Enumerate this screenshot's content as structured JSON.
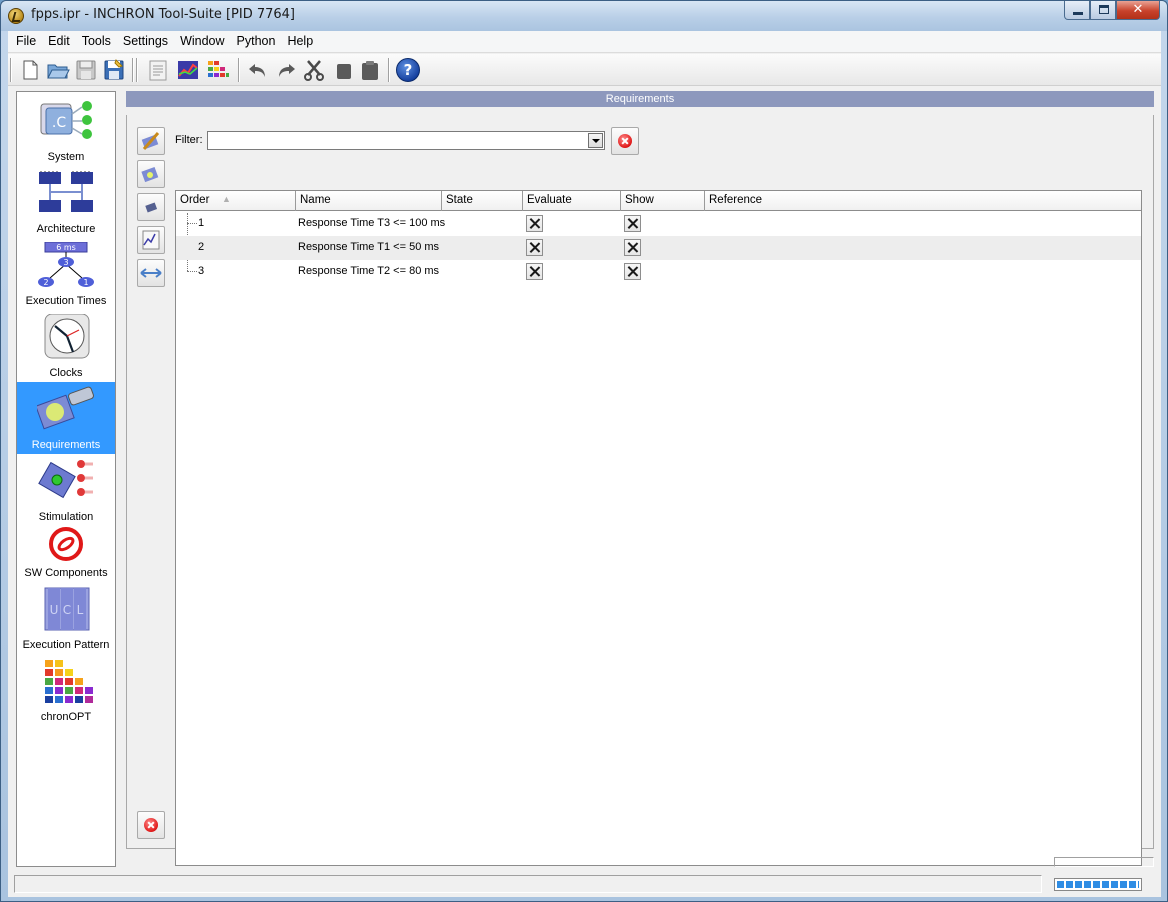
{
  "window": {
    "title": "fpps.ipr - INCHRON Tool-Suite [PID 7764]",
    "close_glyph": "✕"
  },
  "menu": [
    "File",
    "Edit",
    "Tools",
    "Settings",
    "Window",
    "Python",
    "Help"
  ],
  "toolbar": {
    "icons": [
      "new-file-icon",
      "open-folder-icon",
      "save-icon",
      "save-as-icon",
      "report-icon",
      "chart-icon",
      "chronopt-icon",
      "undo-icon",
      "redo-icon",
      "cut-icon",
      "copy-icon",
      "paste-icon",
      "help-icon"
    ],
    "help_glyph": "?"
  },
  "sidebar": {
    "items": [
      {
        "label": "System",
        "icon": "system-icon",
        "active": false
      },
      {
        "label": "Architecture",
        "icon": "architecture-icon",
        "active": false
      },
      {
        "label": "Execution Times",
        "icon": "execution-times-icon",
        "active": false
      },
      {
        "label": "Clocks",
        "icon": "clock-icon",
        "active": false
      },
      {
        "label": "Requirements",
        "icon": "requirements-icon",
        "active": true
      },
      {
        "label": "Stimulation",
        "icon": "stimulation-icon",
        "active": false
      },
      {
        "label": "SW Components",
        "icon": "sw-components-icon",
        "active": false
      },
      {
        "label": "Execution Pattern",
        "icon": "execution-pattern-icon",
        "active": false
      },
      {
        "label": "chronOPT",
        "icon": "chronopt-icon",
        "active": false
      }
    ],
    "exec_times_badge": "6 ms",
    "exec_nodes": [
      "3",
      "2",
      "1"
    ],
    "pattern_letters": [
      "U",
      "C",
      "L"
    ],
    "system_letter": ".C"
  },
  "panel": {
    "title": "Requirements",
    "filter_label": "Filter:",
    "filter_value": "",
    "columns": [
      "Order",
      "Name",
      "State",
      "Evaluate",
      "Show",
      "Reference"
    ],
    "sort_indicator": "▲",
    "rows": [
      {
        "order": "1",
        "name": "Response Time T3 <= 100 ms",
        "state": "",
        "evaluate": true,
        "show": true,
        "reference": ""
      },
      {
        "order": "2",
        "name": "Response Time T1 <= 50 ms",
        "state": "",
        "evaluate": true,
        "show": true,
        "reference": ""
      },
      {
        "order": "3",
        "name": "Response Time T2 <= 80 ms",
        "state": "",
        "evaluate": true,
        "show": true,
        "reference": ""
      }
    ]
  },
  "colors": {
    "accent": "#3399ff",
    "header": "#8d98bd",
    "danger": "#e01818"
  }
}
